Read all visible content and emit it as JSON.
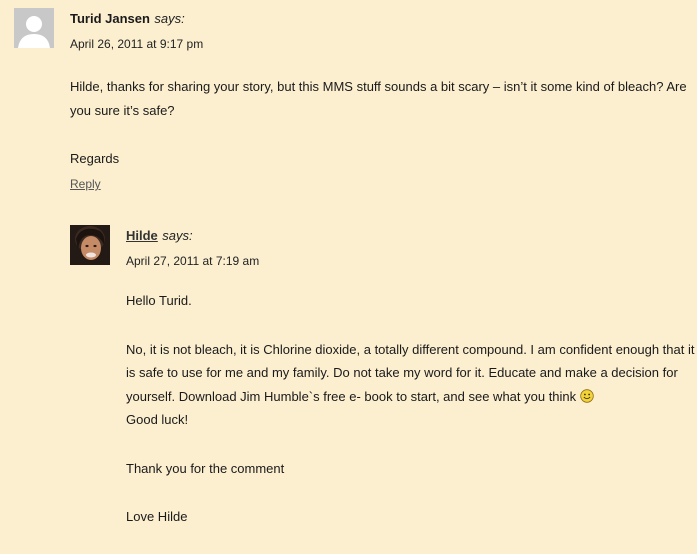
{
  "comments": [
    {
      "author": "Turid Jansen",
      "says": "says:",
      "date": "April 26, 2011 at 9:17 pm",
      "paragraphs": [
        "Hilde, thanks for sharing your story, but this MMS stuff sounds a bit scary – isn’t it some kind of bleach? Are you sure it’s safe?",
        "Regards"
      ],
      "reply_label": "Reply"
    },
    {
      "author": "Hilde",
      "says": "says:",
      "date": "April 27, 2011 at 7:19 am",
      "paragraphs": [
        "Hello Turid.",
        "No, it is not bleach, it is Chlorine dioxide, a totally different compound. I am confident enough that it is safe to use for me and my family. Do not take my word for it. Educate and make a decision for yourself. Download Jim Humble`s free e- book to start, and see what you think",
        "Good luck!",
        "Thank you for the comment",
        "Love Hilde"
      ]
    }
  ],
  "colors": {
    "background": "#fcefd0",
    "text": "#1a1a1a",
    "smiley": "#f2d33a"
  },
  "icons": {
    "smiley": "smiley-icon"
  }
}
